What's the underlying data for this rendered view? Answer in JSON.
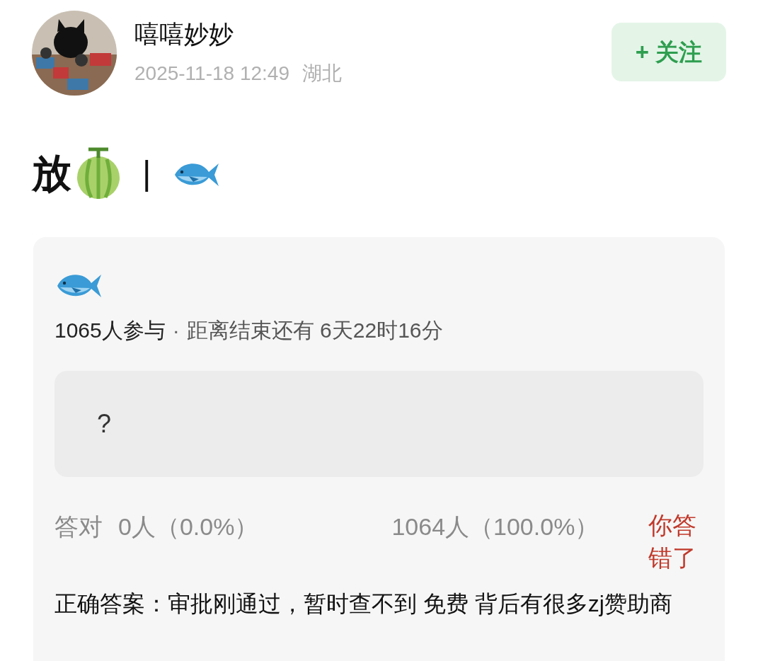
{
  "author": {
    "name": "嘻嘻妙妙",
    "time": "2025-11-18 12:49",
    "location": "湖北"
  },
  "follow_button": {
    "label": "+ 关注"
  },
  "post_title": {
    "text": "放",
    "separator": "|"
  },
  "quiz": {
    "participants": "1065人参与",
    "separator": "·",
    "countdown": "距离结束还有 6天22时16分",
    "options": [
      {
        "label": "?"
      }
    ],
    "results": {
      "correct_label": "答对",
      "correct_count": "0人（0.0%）",
      "wrong_count": "1064人（100.0%）",
      "verdict": "你答错了"
    },
    "answer": "正确答案：审批刚通过，暂时查不到 免费 背后有很多zj赞助商"
  }
}
